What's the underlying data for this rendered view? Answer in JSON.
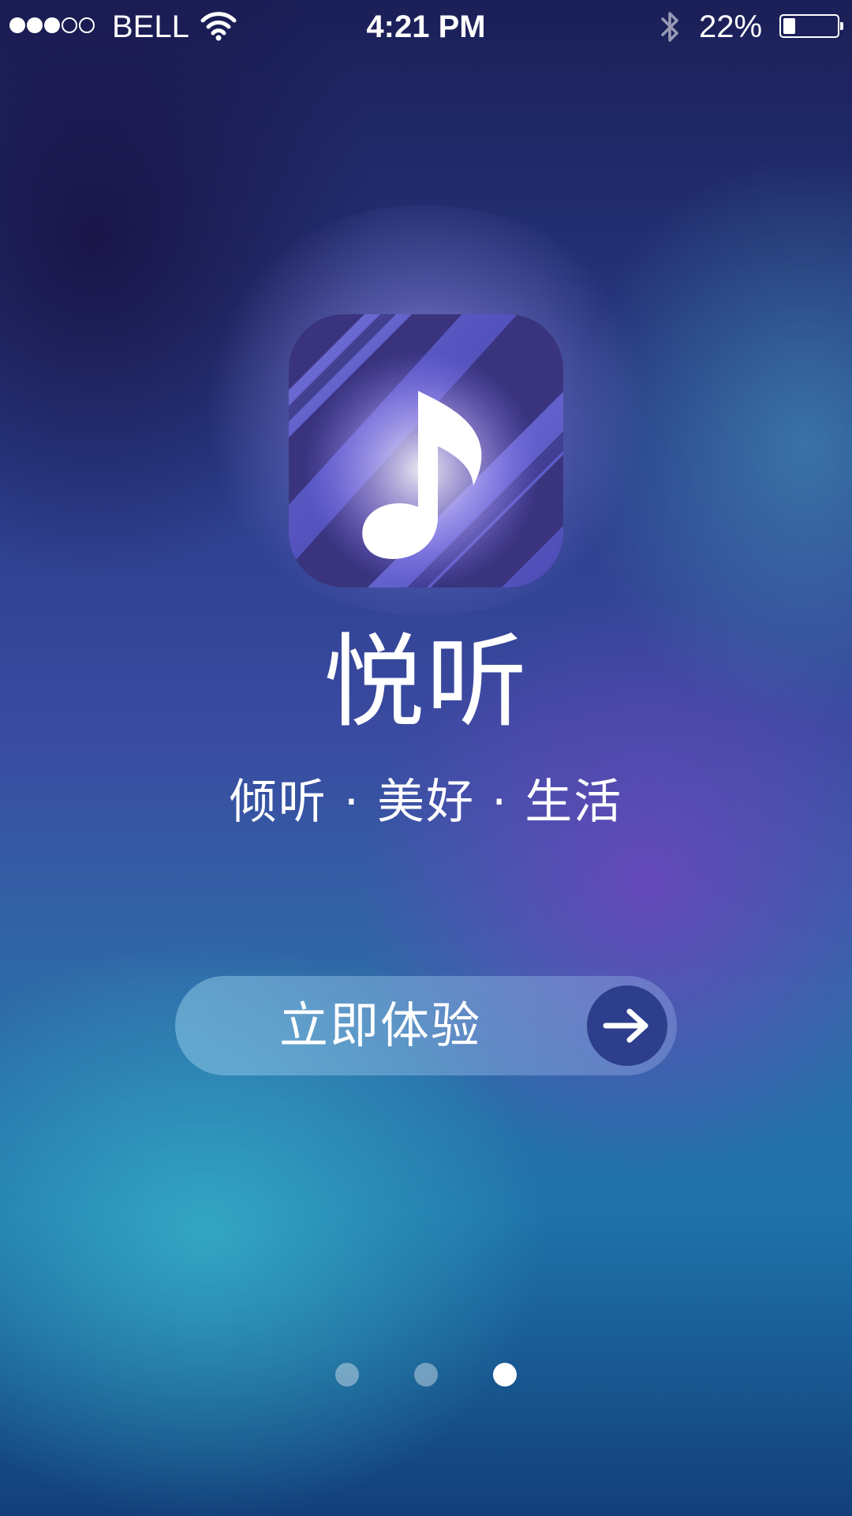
{
  "status_bar": {
    "carrier": "BELL",
    "time": "4:21 PM",
    "battery_text": "22%",
    "battery_level": 0.22,
    "signal_bars_filled": 3,
    "signal_bars_total": 5
  },
  "app": {
    "name": "悦听",
    "tagline": "倾听 · 美好 · 生活",
    "logo_icon": "music-note-icon"
  },
  "cta": {
    "label": "立即体验",
    "icon": "arrow-right-icon"
  },
  "pager": {
    "total": 3,
    "active_index": 2
  },
  "colors": {
    "cta_arrow_bg": "#2c3e8c",
    "logo_primary": "#5a57c8",
    "logo_dark": "#36327a"
  }
}
